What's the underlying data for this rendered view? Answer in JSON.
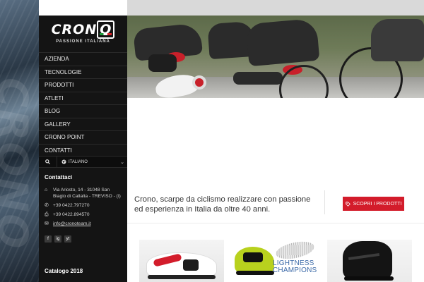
{
  "brand": {
    "logo_text": "CRON",
    "logo_last_letter": "O",
    "tagline": "PASSIONE ITALIANA",
    "colors": {
      "accent_red": "#d31c2b",
      "sidebar_bg": "#141414",
      "flag_green": "#1e9a3a",
      "flag_red": "#d8232a"
    }
  },
  "nav": {
    "items": [
      {
        "label": "AZIENDA"
      },
      {
        "label": "TECNOLOGIE"
      },
      {
        "label": "PRODOTTI"
      },
      {
        "label": "ATLETI"
      },
      {
        "label": "BLOG"
      },
      {
        "label": "GALLERY"
      },
      {
        "label": "CRONO POINT"
      },
      {
        "label": "CONTATTI"
      }
    ]
  },
  "toolbar": {
    "search_icon": "search-icon",
    "language_label": "ITALIANO",
    "language_icon": "globe-icon",
    "dropdown_icon": "chevron-down-icon"
  },
  "contacts": {
    "title": "Contattaci",
    "address": "Via Ariosto, 14 - 31048 San Biagio di Callalta - TREVISO - (I)",
    "phone": "+39 0422.797270",
    "fax": "+39 0422.894570",
    "email": "info@cronoteam.it"
  },
  "social": [
    "f",
    "ig",
    "yt"
  ],
  "catalog_label": "Catalogo 2018",
  "intro": {
    "text": "Crono, scarpe da ciclismo realizzare con passione ed esperienza in Italia da oltre 40 anni.",
    "cta_label": "SCOPRI I PRODOTTI"
  },
  "cards": {
    "card2_title_line1": "LIGHTNESS",
    "card2_title_line2": "CHAMPIONS"
  }
}
